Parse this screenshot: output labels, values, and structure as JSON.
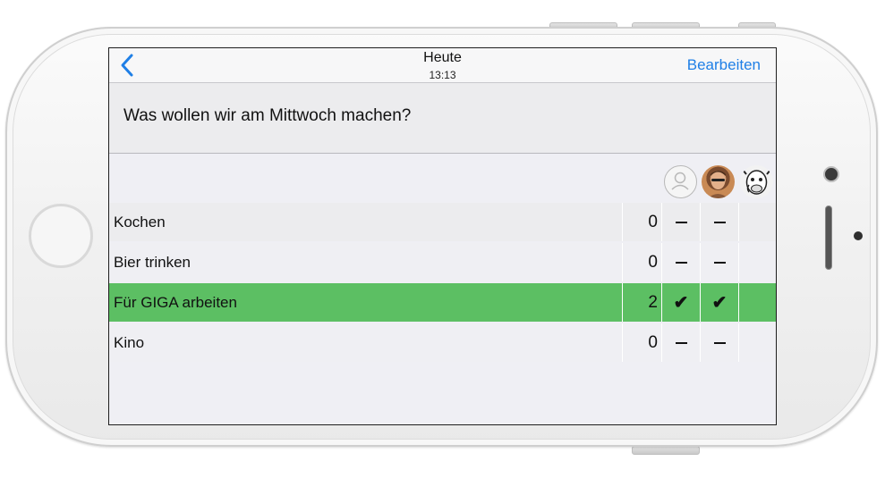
{
  "nav": {
    "title": "Heute",
    "subtitle": "13:13",
    "edit_label": "Bearbeiten"
  },
  "question": "Was wollen wir am Mittwoch machen?",
  "participants": [
    {
      "avatar": "empty-user-icon"
    },
    {
      "avatar": "user-photo"
    },
    {
      "avatar": "cow-avatar"
    }
  ],
  "options": [
    {
      "label": "Kochen",
      "count": "0",
      "votes": [
        "dash",
        "dash",
        ""
      ]
    },
    {
      "label": "Bier trinken",
      "count": "0",
      "votes": [
        "dash",
        "dash",
        ""
      ]
    },
    {
      "label": "Für GIGA arbeiten",
      "count": "2",
      "votes": [
        "check",
        "check",
        ""
      ],
      "highlight": true
    },
    {
      "label": "Kino",
      "count": "0",
      "votes": [
        "dash",
        "dash",
        ""
      ]
    }
  ],
  "colors": {
    "accent": "#1f7fe6",
    "winner_row": "#5cbf63"
  },
  "symbols": {
    "check": "✔"
  }
}
